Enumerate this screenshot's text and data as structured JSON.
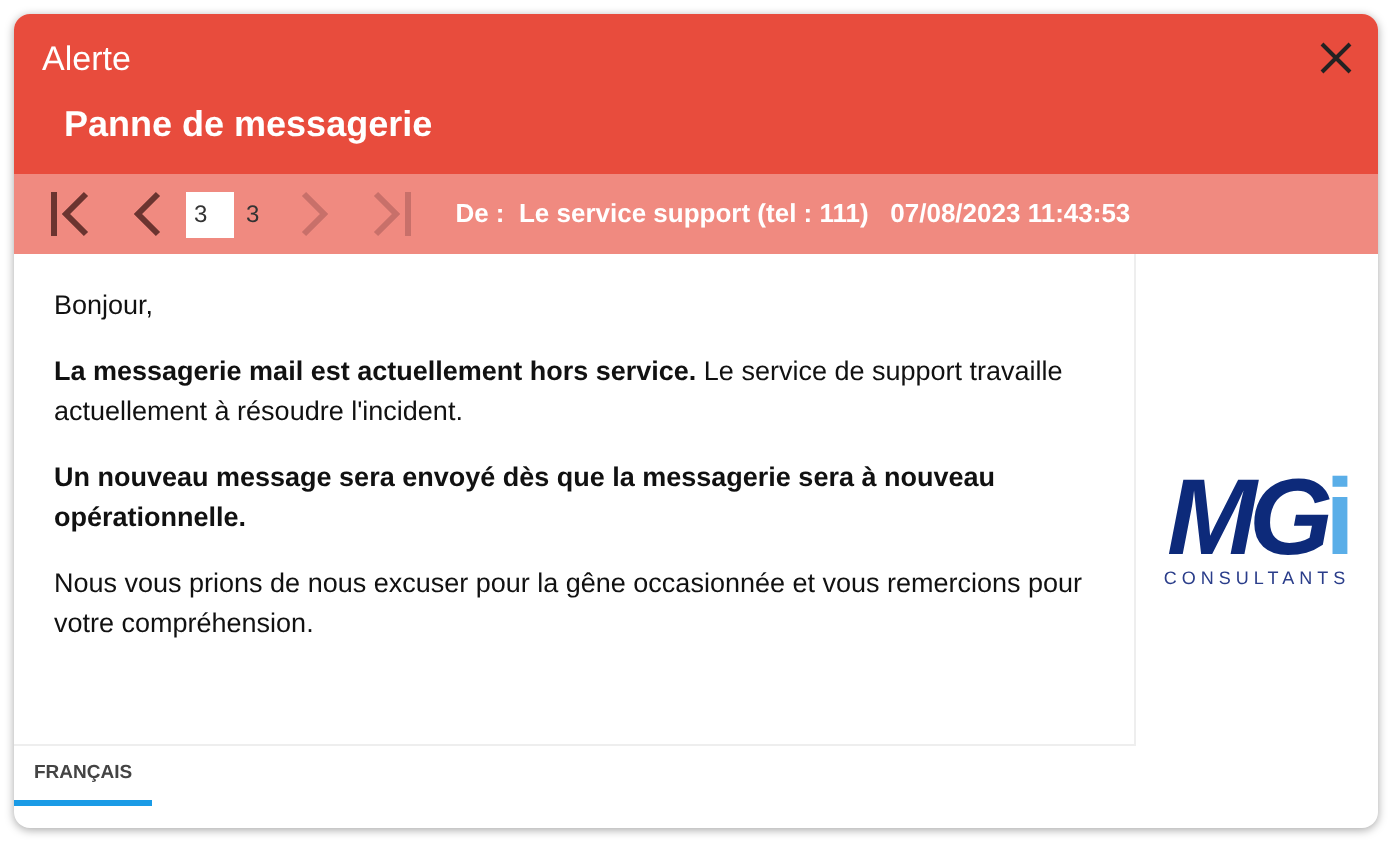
{
  "window": {
    "title": "Alerte",
    "subtitle": "Panne de messagerie"
  },
  "nav": {
    "buttons": [
      {
        "kind": "first",
        "disabled": false
      },
      {
        "kind": "prev",
        "disabled": false
      },
      {
        "kind": "next",
        "disabled": true
      },
      {
        "kind": "last",
        "disabled": true
      }
    ],
    "page": "3",
    "total": "3"
  },
  "sender": {
    "label": "De :",
    "value": "Le service support (tel : 111)",
    "date": "07/08/2023 11:43:53"
  },
  "message": [
    "Bonjour,",
    "**La messagerie mail est actuellement hors service.** Le service de support travaille actuellement à résoudre l'incident.",
    "**Un nouveau message sera envoyé dès que la messagerie sera à nouveau opérationnelle.**",
    "Nous vous prions de nous excuser pour la gêne occasionnée et vous remercions pour votre compréhension."
  ],
  "logo": {
    "mark": "MG",
    "mark_end": "i",
    "caption": "CONSULTANTS"
  },
  "tabs": [
    {
      "label": "FRANÇAIS",
      "selected": true
    }
  ]
}
